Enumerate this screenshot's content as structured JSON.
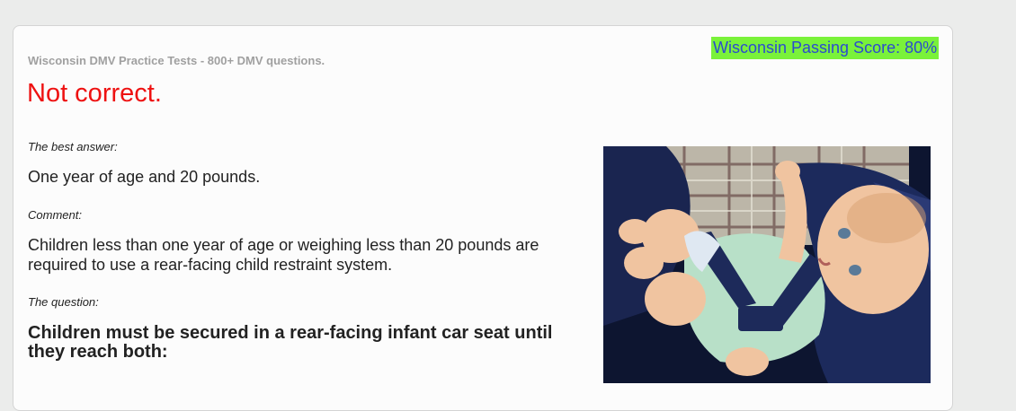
{
  "header": {
    "site_title": "Wisconsin DMV Practice Tests - 800+ DMV questions.",
    "passing_score": "Wisconsin Passing Score: 80%"
  },
  "result": {
    "title": "Not correct."
  },
  "best_answer": {
    "label": "The best answer:",
    "text": "One year of age and 20 pounds."
  },
  "comment": {
    "label": "Comment:",
    "text": "Children less than one year of age or weighing less than 20 pounds are required to use a rear-facing child restraint system."
  },
  "question": {
    "label": "The question:",
    "text": "Children must be secured in a rear-facing infant car seat until they reach both:"
  },
  "image": {
    "description": "baby-in-car-seat-photo"
  },
  "colors": {
    "background": "#ebeceb",
    "card": "#fcfcfc",
    "error_red": "#ee1111",
    "score_badge_bg": "#7af23a",
    "score_badge_text": "#2b4bd0"
  }
}
